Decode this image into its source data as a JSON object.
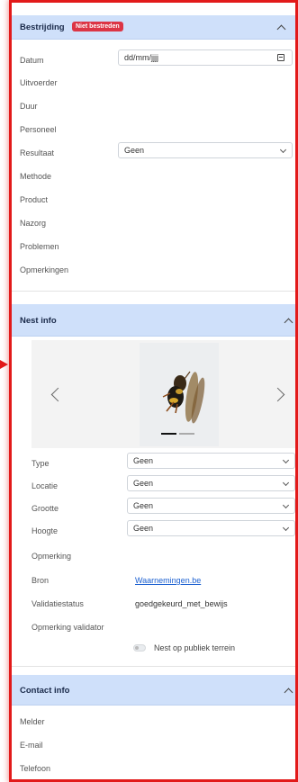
{
  "bestrijding": {
    "title": "Bestrijding",
    "badge": "Niet bestreden",
    "fields": [
      {
        "label": "Datum"
      },
      {
        "label": "Uitvoerder"
      },
      {
        "label": "Duur"
      },
      {
        "label": "Personeel"
      },
      {
        "label": "Resultaat"
      },
      {
        "label": "Methode"
      },
      {
        "label": "Product"
      },
      {
        "label": "Nazorg"
      },
      {
        "label": "Problemen"
      },
      {
        "label": "Opmerkingen"
      }
    ],
    "datum_placeholder": "dd/mm/jjjj",
    "resultaat_value": "Geen"
  },
  "nest_info": {
    "title": "Nest info",
    "carousel": {
      "slide_count": 2,
      "active_slide": 1
    },
    "type_label": "Type",
    "type_value": "Geen",
    "locatie_label": "Locatie",
    "locatie_value": "Geen",
    "grootte_label": "Grootte",
    "grootte_value": "Geen",
    "hoogte_label": "Hoogte",
    "hoogte_value": "Geen",
    "opmerking_label": "Opmerking",
    "bron_label": "Bron",
    "bron_value": "Waarnemingen.be",
    "validatie_label": "Validatiestatus",
    "validatie_value": "goedgekeurd_met_bewijs",
    "opmerking_validator_label": "Opmerking validator",
    "publiek_label": "Nest op publiek terrein"
  },
  "contact_info": {
    "title": "Contact info",
    "melder_label": "Melder",
    "email_label": "E-mail",
    "telefoon_label": "Telefoon"
  },
  "colors": {
    "accent_red": "#e21a1a",
    "header_blue": "#cfe0fa",
    "badge_red": "#dc3545",
    "link_blue": "#1a5fd0"
  }
}
